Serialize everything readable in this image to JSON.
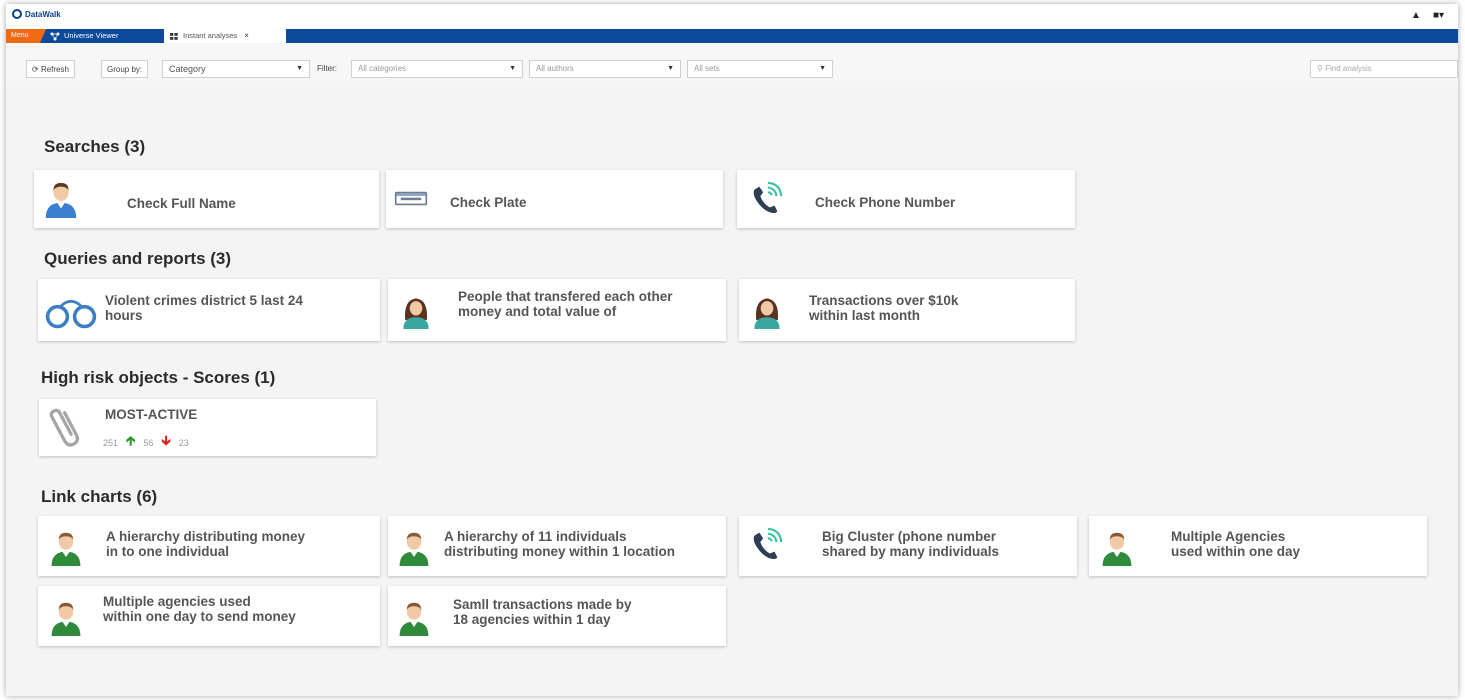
{
  "app": {
    "title": "DataWalk"
  },
  "tabs": {
    "menu": "Menu",
    "universe": "Universe Viewer",
    "instant": "Instant analyses"
  },
  "toolbar": {
    "refresh": "Refresh",
    "group_by_label": "Group by:",
    "group_by_value": "Category",
    "filter_label": "Filter:",
    "filter_categories": "All categories",
    "filter_authors": "All authors",
    "filter_sets": "All sets",
    "search_placeholder": "Find analysis"
  },
  "sections": {
    "searches": {
      "title": "Searches (3)",
      "items": [
        {
          "label": "Check Full Name",
          "icon": "person-icon"
        },
        {
          "label": "Check Plate",
          "icon": "license-plate-icon"
        },
        {
          "label": "Check Phone Number",
          "icon": "phone-icon"
        }
      ]
    },
    "queries": {
      "title": "Queries and reports (3)",
      "items": [
        {
          "line1": "Violent crimes district 5 last 24",
          "line2": "hours",
          "icon": "handcuffs-icon"
        },
        {
          "line1": "People that transfered each other",
          "line2": "money and total value of",
          "icon": "woman-icon"
        },
        {
          "line1": "Transactions over $10k",
          "line2": "within last month",
          "icon": "woman-icon"
        }
      ]
    },
    "scores": {
      "title": "High risk objects - Scores (1)",
      "items": [
        {
          "label": "MOST-ACTIVE",
          "total": "251",
          "up": "56",
          "down": "23",
          "icon": "paperclip-icon"
        }
      ]
    },
    "linkcharts": {
      "title": "Link charts (6)",
      "items": [
        {
          "line1": "A hierarchy distributing money",
          "line2": "in to one individual",
          "icon": "person-green-icon"
        },
        {
          "line1": "A hierarchy of 11 individuals",
          "line2": "distributing money within 1 location",
          "icon": "person-green-icon"
        },
        {
          "line1": "Big Cluster (phone number",
          "line2": "shared by many individuals",
          "icon": "phone-icon"
        },
        {
          "line1": "Multiple Agencies",
          "line2": "used within one day",
          "icon": "person-green-icon"
        },
        {
          "line1": "Multiple agencies used",
          "line2": "within one day to send money",
          "icon": "person-green-icon"
        },
        {
          "line1": "Samll transactions made by",
          "line2": "18 agencies within 1 day",
          "icon": "person-green-icon"
        }
      ]
    }
  },
  "colors": {
    "brand_blue": "#0c4a9c",
    "menu_orange": "#ee6b12",
    "up_green": "#2c9b2c",
    "down_red": "#d9261c"
  }
}
